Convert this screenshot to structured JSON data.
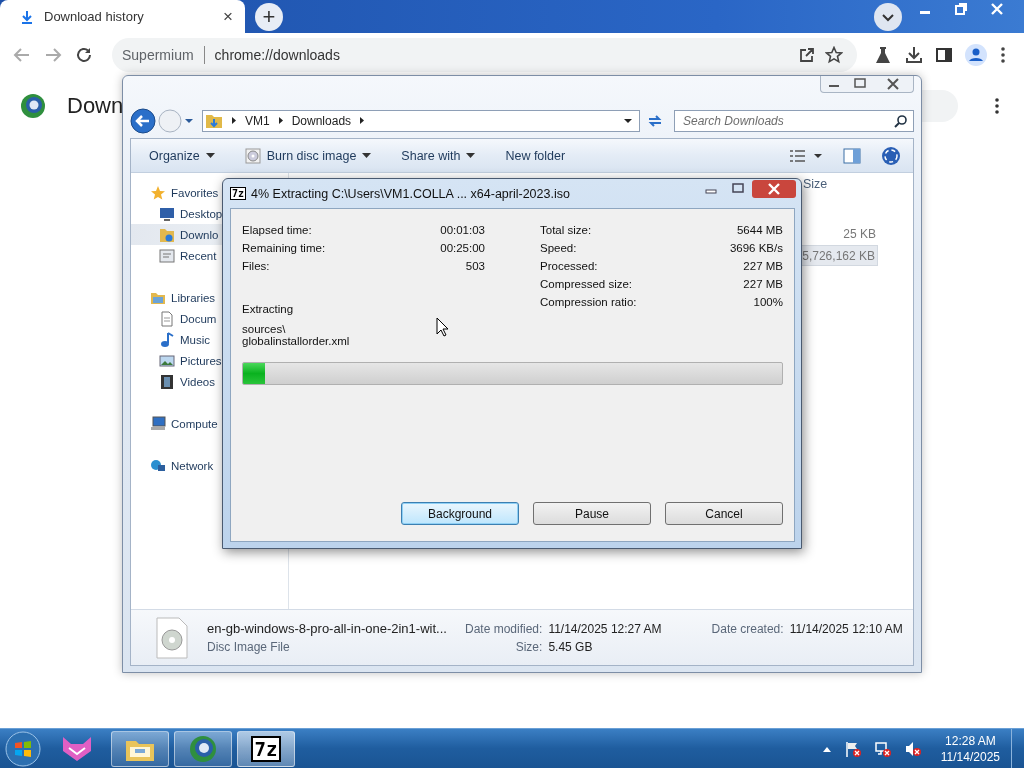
{
  "browser": {
    "tabs": [
      {
        "title": "Download history",
        "close": "×",
        "selected": true
      }
    ],
    "new_tab": "+",
    "address": {
      "site": "Supermium",
      "url": "chrome://downloads"
    },
    "page_title": "Down"
  },
  "explorer": {
    "path": [
      "VM1",
      "Downloads"
    ],
    "search": {
      "placeholder": "Search Downloads"
    },
    "commands": [
      {
        "label": "Organize",
        "kind": "menu"
      },
      {
        "label": "Burn disc image",
        "kind": "disc-menu"
      },
      {
        "label": "Share with",
        "kind": "menu"
      },
      {
        "label": "New folder",
        "kind": "plain"
      }
    ],
    "nav": [
      {
        "label": "Favorites",
        "kind": "star",
        "selected": false,
        "children": [
          {
            "label": "Desktop",
            "kind": "desktop",
            "selected": false
          },
          {
            "label": "Downlo",
            "kind": "downloads",
            "selected": true
          },
          {
            "label": "Recent",
            "kind": "recent",
            "selected": false
          }
        ]
      },
      {
        "label": "Libraries",
        "kind": "library",
        "selected": false,
        "children": [
          {
            "label": "Docum",
            "kind": "document",
            "selected": false
          },
          {
            "label": "Music",
            "kind": "music",
            "selected": false
          },
          {
            "label": "Pictures",
            "kind": "pictures",
            "selected": false
          },
          {
            "label": "Videos",
            "kind": "videos",
            "selected": false
          }
        ]
      },
      {
        "label": "Compute",
        "kind": "computer",
        "selected": false
      },
      {
        "label": "Network",
        "kind": "network",
        "selected": false
      }
    ],
    "column_header": "Size",
    "rows": [
      {
        "size": "25 KB",
        "selected": false
      },
      {
        "size": "5,726,162 KB",
        "selected": true
      }
    ],
    "details": {
      "name": "en-gb-windows-8-pro-all-in-one-2in1-wit...",
      "type": "Disc Image File",
      "fields": [
        {
          "label": "Date modified:",
          "value": "11/14/2025 12:27 AM"
        },
        {
          "label": "Date created:",
          "value": "11/14/2025 12:10 AM"
        },
        {
          "label": "Size:",
          "value": "5.45 GB"
        }
      ]
    }
  },
  "dialog": {
    "icon_text": "7z",
    "title": "4% Extracting C:\\Users\\VM1.COLLA ... x64-april-2023.iso",
    "left": [
      {
        "label": "Elapsed time:",
        "value": "00:01:03"
      },
      {
        "label": "Remaining time:",
        "value": "00:25:00"
      },
      {
        "label": "Files:",
        "value": "503"
      }
    ],
    "right": [
      {
        "label": "Total size:",
        "value": "5644 MB"
      },
      {
        "label": "Speed:",
        "value": "3696 KB/s"
      },
      {
        "label": "Processed:",
        "value": "227 MB"
      },
      {
        "label": "Compressed size:",
        "value": "227 MB"
      },
      {
        "label": "Compression ratio:",
        "value": "100%"
      }
    ],
    "status": "Extracting",
    "current": [
      "sources\\",
      "globalinstallorder.xml"
    ],
    "progress": {
      "level": 0.04
    },
    "buttons": [
      {
        "label": "Background",
        "default": true
      },
      {
        "label": "Pause",
        "default": false
      },
      {
        "label": "Cancel",
        "default": false
      }
    ]
  },
  "taskbar": {
    "apps": [
      {
        "kind": "cat",
        "running": false,
        "selected": false
      },
      {
        "kind": "folder",
        "running": true,
        "selected": false
      },
      {
        "kind": "globe",
        "running": true,
        "selected": false
      },
      {
        "kind": "sevenzip",
        "label": "7z",
        "running": true,
        "selected": true
      }
    ],
    "clock": {
      "time": "12:28 AM",
      "date": "11/14/2025"
    }
  }
}
